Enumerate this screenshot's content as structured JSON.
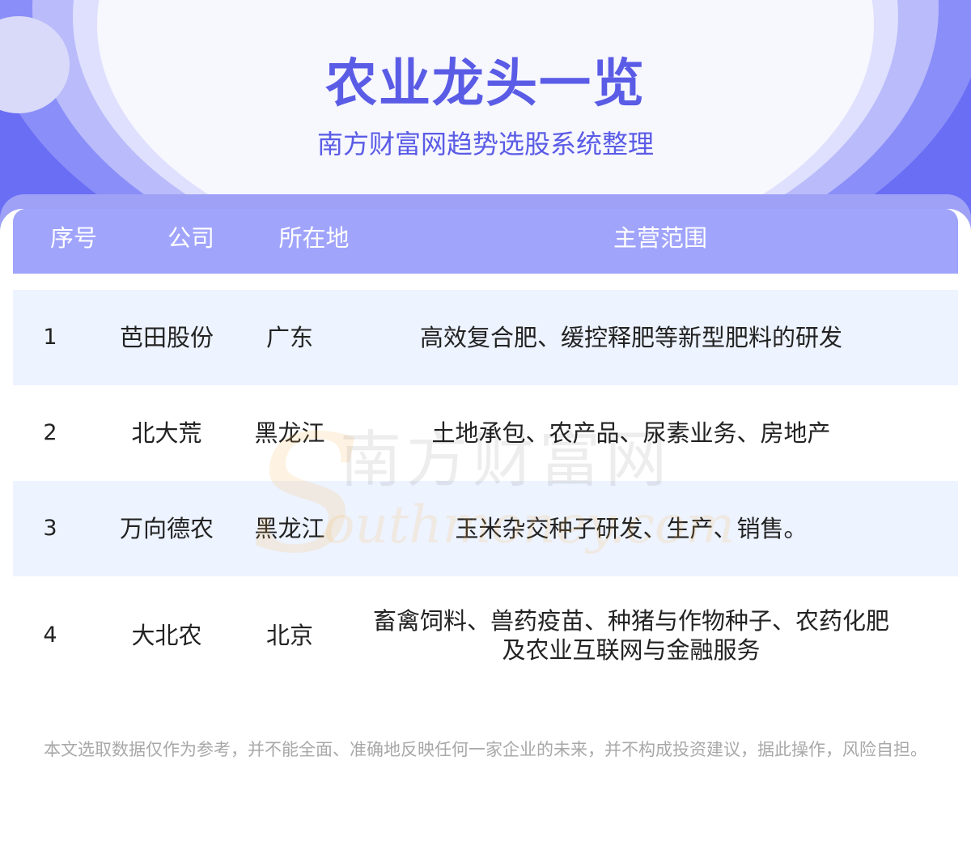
{
  "header": {
    "title": "农业龙头一览",
    "subtitle": "南方财富网趋势选股系统整理"
  },
  "table": {
    "headers": [
      "序号",
      "公司",
      "所在地",
      "主营范围"
    ],
    "rows": [
      {
        "index": "1",
        "company": "芭田股份",
        "location": "广东",
        "business": "高效复合肥、缓控释肥等新型肥料的研发"
      },
      {
        "index": "2",
        "company": "北大荒",
        "location": "黑龙江",
        "business": "土地承包、农产品、尿素业务、房地产"
      },
      {
        "index": "3",
        "company": "万向德农",
        "location": "黑龙江",
        "business": "玉米杂交种子研发、生产、销售。"
      },
      {
        "index": "4",
        "company": "大北农",
        "location": "北京",
        "business": "畜禽饲料、兽药疫苗、种猪与作物种子、农药化肥及农业互联网与金融服务"
      }
    ]
  },
  "watermark": {
    "text_cn": "南方财富网",
    "text_en": "outhmoney.com",
    "logo_letter": "S"
  },
  "footer": {
    "disclaimer": "本文选取数据仅作为参考，并不能全面、准确地反映任何一家企业的未来，并不构成投资建议，据此操作，风险自担。"
  },
  "colors": {
    "accent": "#5a5ce6",
    "header_bg": "#a0a4fb",
    "row_shade": "#edf3ff"
  }
}
